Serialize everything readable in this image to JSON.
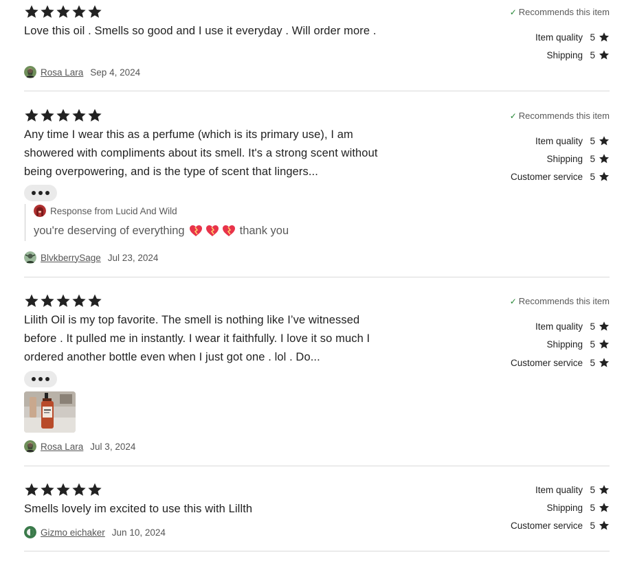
{
  "reviews": [
    {
      "rating": 5,
      "text": "Love this oil . Smells so good and I use it everyday . Will order more .",
      "author": "Rosa Lara",
      "date": "Sep 4, 2024",
      "recommends": "Recommends this item",
      "ratings": [
        {
          "label": "Item quality",
          "score": "5"
        },
        {
          "label": "Shipping",
          "score": "5"
        }
      ]
    },
    {
      "rating": 5,
      "text": "Any time I wear this as a perfume (which is its primary use), I am showered with compliments about its smell. It's a strong scent without being overpowering, and is the type of scent that lingers...",
      "author": "BlvkberrySage",
      "date": "Jul 23, 2024",
      "recommends": "Recommends this item",
      "response": {
        "heading": "Response from Lucid And Wild",
        "text": "you're deserving of everything",
        "text_after": "thank you"
      },
      "ratings": [
        {
          "label": "Item quality",
          "score": "5"
        },
        {
          "label": "Shipping",
          "score": "5"
        },
        {
          "label": "Customer service",
          "score": "5"
        }
      ]
    },
    {
      "rating": 5,
      "text": "Lilith Oil is my top favorite. The smell is nothing like I’ve witnessed before . It pulled me in instantly. I wear it faithfully. I love it so much I ordered another bottle even when I just got one . lol . Do...",
      "author": "Rosa Lara",
      "date": "Jul 3, 2024",
      "recommends": "Recommends this item",
      "ratings": [
        {
          "label": "Item quality",
          "score": "5"
        },
        {
          "label": "Shipping",
          "score": "5"
        },
        {
          "label": "Customer service",
          "score": "5"
        }
      ]
    },
    {
      "rating": 5,
      "text": "Smells lovely im excited to use this with Lillth",
      "author": "Gizmo eichaker",
      "date": "Jun 10, 2024",
      "ratings": [
        {
          "label": "Item quality",
          "score": "5"
        },
        {
          "label": "Shipping",
          "score": "5"
        },
        {
          "label": "Customer service",
          "score": "5"
        }
      ]
    }
  ],
  "colors": {
    "text": "#222222",
    "muted": "#595959",
    "check": "#258635",
    "divider": "#d9d9d9",
    "pill": "#eaeaea"
  },
  "icons": [
    "star-icon",
    "check-icon",
    "more-dots-icon",
    "heart-icon"
  ]
}
